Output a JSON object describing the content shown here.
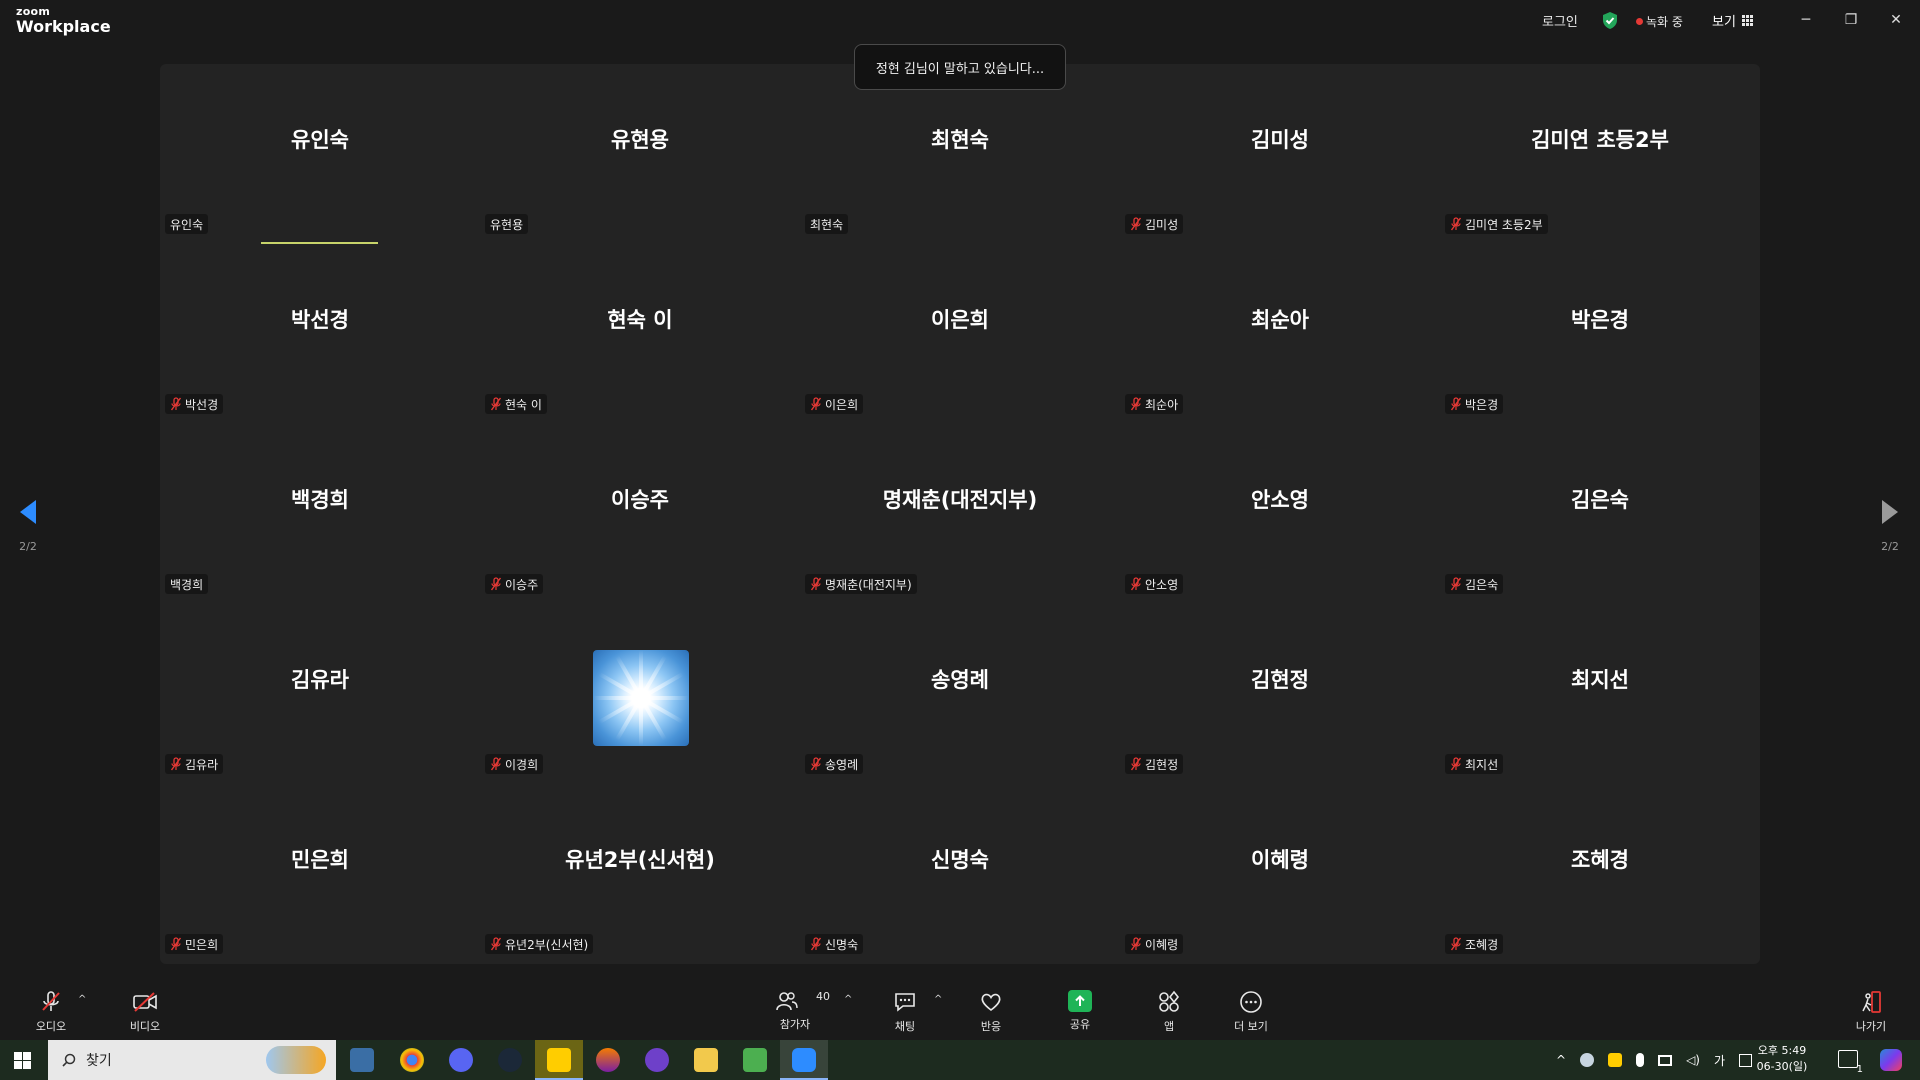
{
  "titlebar": {
    "logo_small": "zoom",
    "logo_big": "Workplace",
    "login": "로그인",
    "recording": "녹화 중",
    "view": "보기",
    "minimize": "─",
    "restore": "❐",
    "close": "✕"
  },
  "toast": "정현 김님이 말하고 있습니다...",
  "pager": {
    "left_page": "2/2",
    "right_page": "2/2"
  },
  "tiles": [
    {
      "big": "유인숙",
      "label": "유인숙",
      "muted": false
    },
    {
      "big": "유현용",
      "label": "유현용",
      "muted": false
    },
    {
      "big": "최현숙",
      "label": "최현숙",
      "muted": false
    },
    {
      "big": "김미성",
      "label": "김미성",
      "muted": true
    },
    {
      "big": "김미연 초등2부",
      "label": "김미연 초등2부",
      "muted": true
    },
    {
      "big": "박선경",
      "label": "박선경",
      "muted": true
    },
    {
      "big": "현숙 이",
      "label": "현숙 이",
      "muted": true
    },
    {
      "big": "이은희",
      "label": "이은희",
      "muted": true
    },
    {
      "big": "최순아",
      "label": "최순아",
      "muted": true
    },
    {
      "big": "박은경",
      "label": "박은경",
      "muted": true
    },
    {
      "big": "백경희",
      "label": "백경희",
      "muted": false
    },
    {
      "big": "이승주",
      "label": "이승주",
      "muted": true
    },
    {
      "big": "명재춘(대전지부)",
      "label": "명재춘(대전지부)",
      "muted": true
    },
    {
      "big": "안소영",
      "label": "안소영",
      "muted": true
    },
    {
      "big": "김은숙",
      "label": "김은숙",
      "muted": true
    },
    {
      "big": "김유라",
      "label": "김유라",
      "muted": true
    },
    {
      "big": "",
      "label": "이경희",
      "muted": true,
      "image": true
    },
    {
      "big": "송영례",
      "label": "송영례",
      "muted": true
    },
    {
      "big": "김현정",
      "label": "김현정",
      "muted": true
    },
    {
      "big": "최지선",
      "label": "최지선",
      "muted": true
    },
    {
      "big": "민은희",
      "label": "민은희",
      "muted": true
    },
    {
      "big": "유년2부(신서현)",
      "label": "유년2부(신서현)",
      "muted": true
    },
    {
      "big": "신명숙",
      "label": "신명숙",
      "muted": true
    },
    {
      "big": "이혜령",
      "label": "이혜령",
      "muted": true
    },
    {
      "big": "조혜경",
      "label": "조혜경",
      "muted": true
    }
  ],
  "toolbar": {
    "audio": "오디오",
    "video": "비디오",
    "participants": "참가자",
    "participants_count": "40",
    "chat": "채팅",
    "reactions": "반응",
    "share": "공유",
    "apps": "앱",
    "more": "더 보기",
    "leave": "나가기",
    "caret": "^"
  },
  "taskbar": {
    "search_placeholder": "찾기",
    "time": "오후 5:49",
    "date": "06-30(일)",
    "ime": "가",
    "notification_count": "1"
  }
}
